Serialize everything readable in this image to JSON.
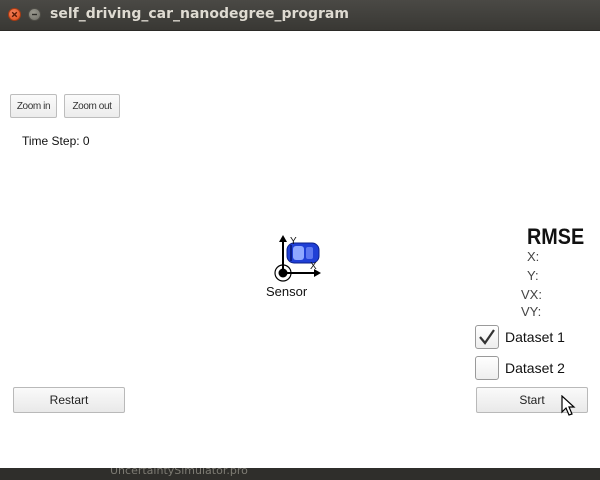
{
  "window": {
    "title": "self_driving_car_nanodegree_program"
  },
  "toolbar": {
    "zoom_in_label": "Zoom in",
    "zoom_out_label": "Zoom out"
  },
  "status": {
    "time_step": "Time Step: 0"
  },
  "scene": {
    "sensor_label": "Sensor",
    "axis_x_label": "X",
    "axis_y_label": "Y",
    "car_color": "#1f3fd6"
  },
  "rmse": {
    "title": "RMSE",
    "x_label": "X:",
    "y_label": "Y:",
    "vx_label": "VX:",
    "vy_label": "VY:"
  },
  "datasets": [
    {
      "label": "Dataset 1",
      "checked": true
    },
    {
      "label": "Dataset 2",
      "checked": false
    }
  ],
  "controls": {
    "restart_label": "Restart",
    "start_label": "Start"
  },
  "taskbar": {
    "fragment": "UncertaintySimulator.pro"
  }
}
